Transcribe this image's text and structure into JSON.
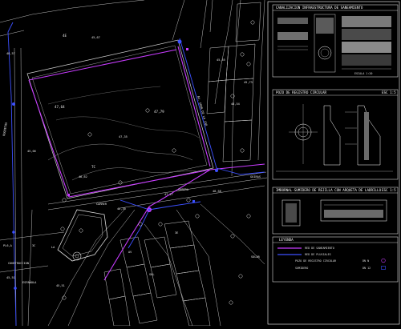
{
  "map": {
    "area_labels": {
      "top_left": "4E",
      "park_mid": "47,64",
      "park_bottom": "TC",
      "park_mid_right": "47,79",
      "park_center": "47,35"
    },
    "elevations": {
      "e1": "45,67",
      "e2": "48,57",
      "e3": "45,55",
      "e4": "45,73",
      "e5": "48,54",
      "e6": "45,06",
      "e7": "48,62",
      "e8": "47,27",
      "e9": "48,58",
      "e10": "46,30",
      "e11": "45,51",
      "e12": "45,51"
    },
    "streets": {
      "left_vertical": "ROQUETAS",
      "bottom_left_1": "CONSTRUCCION",
      "bottom_left_2": "ESPAÑOLA",
      "right_diagonal": "AV. GRAN DE LA CAR",
      "bottom_right": "SOLAR",
      "road_1": "SABERA",
      "road_2": "CARRER",
      "road_3": "GUIRAS"
    },
    "small_labels": {
      "s1": "3C",
      "s2": "LA",
      "s3": "3E",
      "s4": "AV",
      "s5": "SAL",
      "s6": "PL6,A"
    }
  },
  "panels": {
    "sewer_section": {
      "title": "CANALIZACION INFRAESTRUCTURA DE SANEAMIENTO",
      "note": "ESCALA 1:20"
    },
    "manhole": {
      "title": "POZO DE REGISTRO CIRCULAR",
      "tag": "ESC 1:5"
    },
    "drain": {
      "title": "IMBORNAL-SUMIDERO DE REJILLA CON ARQUETA DE LADRILLO",
      "tag": "ESC 1:5"
    },
    "legend": {
      "title": "LEYENDA",
      "items": [
        {
          "label": "RED DE SANEAMIENTO",
          "code": ""
        },
        {
          "label": "RED DE PLUVIALES",
          "code": ""
        },
        {
          "label": "POZO DE REGISTRO CIRCULAR",
          "code": "DN N"
        },
        {
          "label": "SUMIDERO",
          "code": "DN 12"
        }
      ]
    }
  },
  "colors": {
    "background": "#000000",
    "sewer_line": "#c83cff",
    "rain_line": "#3c50ff",
    "panel_border": "#ffffff",
    "panel_title_accent": "#00e0ff",
    "terrain": "#c8c8c8",
    "hatch": "#9a9a9a"
  }
}
